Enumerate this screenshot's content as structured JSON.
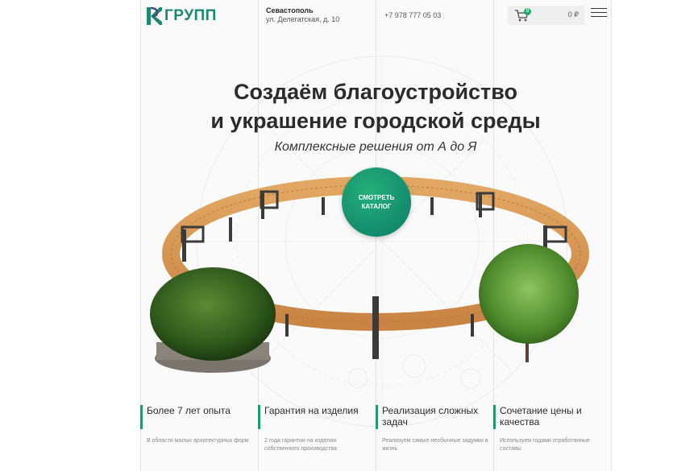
{
  "header": {
    "logo_text": "ГРУПП",
    "city": "Севастополь",
    "address": "ул. Делегатская, д. 10",
    "phone": "+7 978 777 05 03",
    "cart_count": "0",
    "cart_total": "0 ₽"
  },
  "hero": {
    "title_line1": "Создаём благоустройство",
    "title_line2": "и украшение городской среды",
    "subtitle": "Комплексные решения от А до Я",
    "cta_label": "СМОТРЕТЬ КАТАЛОГ"
  },
  "features": [
    {
      "title": "Более 7 лет опыта",
      "desc": "В области малых архитектурных форм"
    },
    {
      "title": "Гарантия на изделия",
      "desc": "2 года гарантии на изделия собственного производства"
    },
    {
      "title": "Реализация сложных задач",
      "desc": "Реализуем самые необычные задумки в жизнь"
    },
    {
      "title": "Сочетание цены и качества",
      "desc": "Используем годами отработанные составы"
    }
  ],
  "colors": {
    "accent": "#1f9a6a",
    "logo": "#1f8a6b",
    "cta": "#15906e"
  }
}
